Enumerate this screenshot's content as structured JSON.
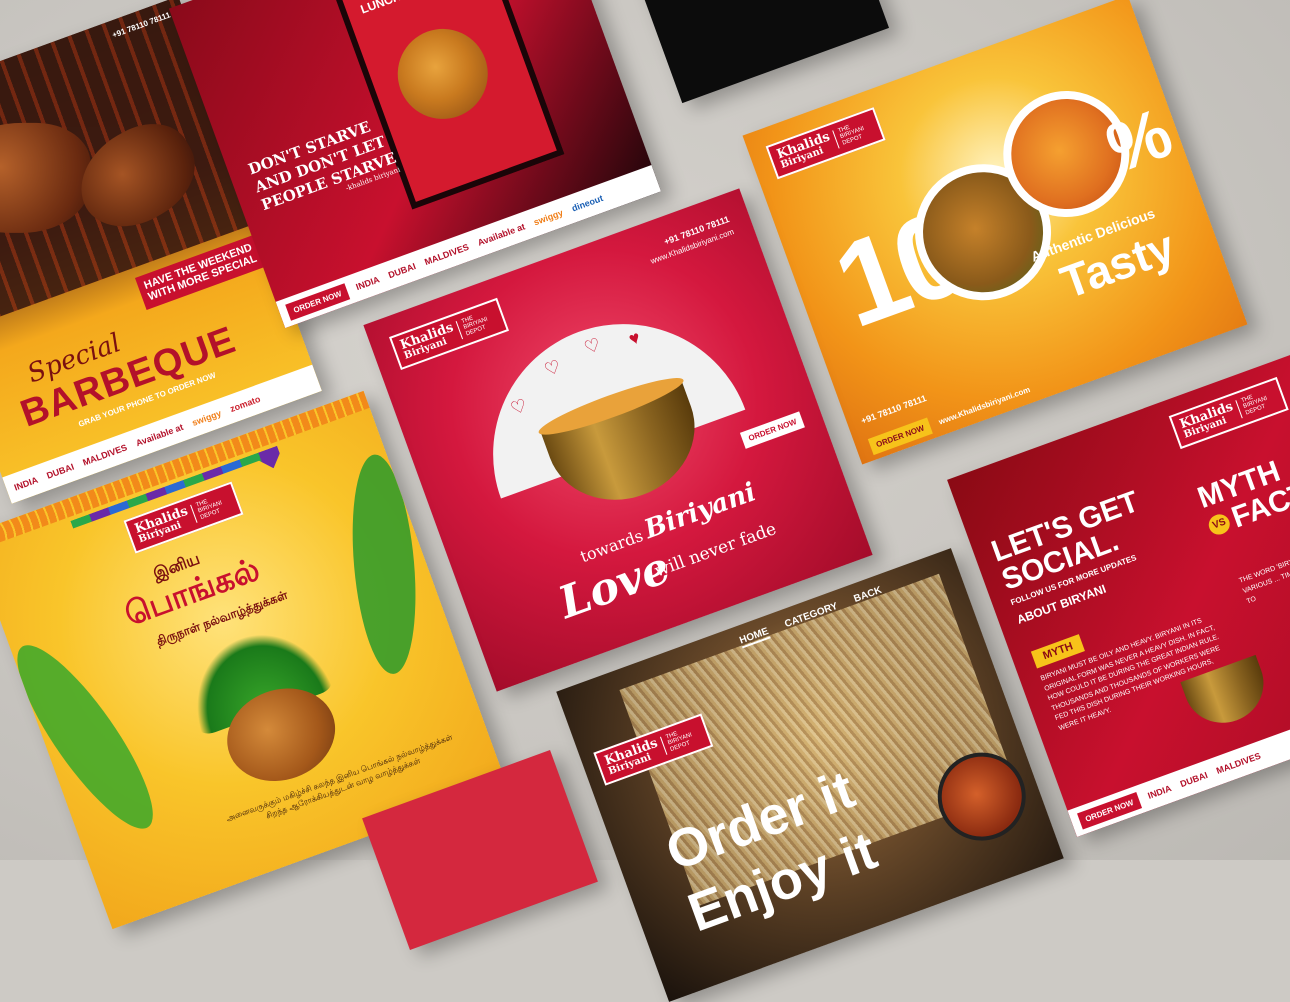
{
  "brand": {
    "name": "Khalids",
    "sub": "Biriyani",
    "tagline": "THE BIRIYANI DEPOT",
    "phone": "+91 78110 78111",
    "website": "www.Khalidsbiriyani.com"
  },
  "common": {
    "order_now": "ORDER NOW",
    "locations": [
      "INDIA",
      "DUBAI",
      "MALDIVES"
    ],
    "available_at": "Available at",
    "delivery": [
      "swiggy",
      "zomato",
      "dineout"
    ]
  },
  "barbeque": {
    "script": "Special",
    "title": "BARBEQUE",
    "sub": "GRAB YOUR PHONE TO ORDER NOW",
    "weekend_line1": "HAVE THE WEEKEND",
    "weekend_line2": "WITH MORE SPECIAL"
  },
  "starve": {
    "header": "LUNCH & BREAK",
    "line1": "DON'T STARVE",
    "line2": "AND DON'T LET",
    "line3": "PEOPLE STARVE",
    "credit": "-khalids biriyani"
  },
  "love": {
    "towards": "towards",
    "biriyani": "Biriyani",
    "love": "Love",
    "never": "will never fade"
  },
  "tasty": {
    "big": "100",
    "pct": "%",
    "line1": "Authentic Delicious",
    "line2": "Tasty"
  },
  "pongal": {
    "line1": "இனிய",
    "line2": "பொங்கல்",
    "line3": "திருநாள் நல்வாழ்த்துக்கள்",
    "body1": "அனைவருக்கும் மகிழ்ச்சி கலந்த இனிய பொங்கல் நல்வாழ்த்துக்கள்",
    "body2": "சிறந்த ஆரோக்கியத்துடன் வாழ வாழ்த்துக்கள்"
  },
  "order": {
    "nav": [
      "HOME",
      "CATEGORY",
      "BACK"
    ],
    "line1": "Order it",
    "line2": "Enjoy it"
  },
  "social": {
    "line1": "LET'S GET",
    "line2": "SOCIAL.",
    "line3": "FOLLOW US FOR MORE UPDATES",
    "line4": "ABOUT BIRYANI",
    "myth_label": "MYTH",
    "myth_title_a": "MYTH",
    "vs": "VS",
    "myth_title_b": "FACT",
    "myth_body": "BIRYANI MUST BE OILY AND HEAVY. BIRYANI IN ITS ORIGINAL FORM WAS NEVER A HEAVY DISH. IN FACT, HOW COULD IT BE DURING THE GREAT INDIAN RULE. THOUSANDS AND THOUSANDS OF WORKERS WERE FED THIS DISH DURING THEIR WORKING HOURS, WERE IT HEAVY.",
    "fact_body": "THE WORD 'BIRYANI' ... THERE ARE VARIOUS ... TIMUR BROUGHT BIRYANI TO"
  },
  "colors": {
    "brand_red": "#c8102e",
    "bg": "#cdcac5",
    "orange": "#f5a623",
    "yellow": "#f7c31a"
  }
}
